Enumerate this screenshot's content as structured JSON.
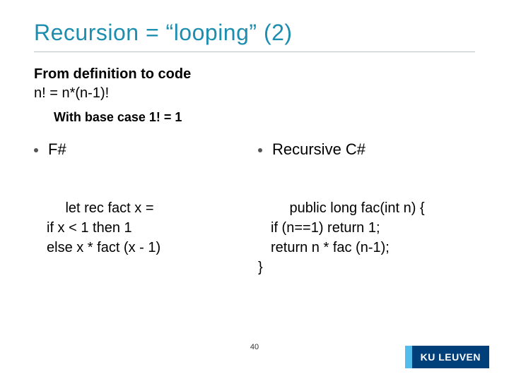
{
  "title": "Recursion = “looping” (2)",
  "intro": {
    "line1": "From definition to code",
    "line2": "n! = n*(n-1)!"
  },
  "basecase": "With base case 1! = 1",
  "left": {
    "heading": "F#",
    "code_l1": "let rec fact x =",
    "code_l2": "if x < 1 then 1",
    "code_l3": "else x * fact (x - 1)"
  },
  "right": {
    "heading": "Recursive C#",
    "code_l1": "public long fac(int n) {",
    "code_l2": "if (n==1) return 1;",
    "code_l3": "return n * fac (n-1);",
    "code_l4": "}"
  },
  "slidenum": "40",
  "logo": "KU LEUVEN"
}
